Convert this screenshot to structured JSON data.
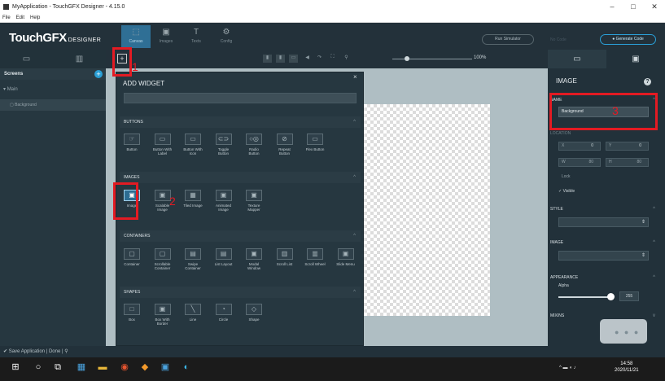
{
  "window": {
    "title": "MyApplication - TouchGFX Designer - 4.15.0",
    "controls": [
      "–",
      "□",
      "✕"
    ]
  },
  "menu": [
    "File",
    "Edit",
    "Help"
  ],
  "logo": {
    "main": "TouchGFX",
    "sub": "DESIGNER"
  },
  "top_tabs": [
    {
      "label": "Canvas",
      "icon": "⬚",
      "active": true
    },
    {
      "label": "Images",
      "icon": "▣",
      "active": false
    },
    {
      "label": "Texts",
      "icon": "T",
      "active": false
    },
    {
      "label": "Config",
      "icon": "⚙",
      "active": false
    }
  ],
  "toolbar": {
    "run_simulator": "Run Simulator",
    "no_code": "No Code",
    "generate_code": "● Generate Code"
  },
  "left_panel": {
    "section": "Screens",
    "tree_main": "Main",
    "tree_background": "Background"
  },
  "canvas": {
    "zoom": "100%",
    "add_widget_icon": "+"
  },
  "add_widget": {
    "title": "ADD WIDGET",
    "close": "×",
    "sections": [
      {
        "name": "BUTTONS",
        "items": [
          {
            "label": "Button",
            "icon": "☞"
          },
          {
            "label": "Button With Label",
            "icon": "▭"
          },
          {
            "label": "Button With Icon",
            "icon": "▭"
          },
          {
            "label": "Toggle Button",
            "icon": "⊂⊃"
          },
          {
            "label": "Radio Button",
            "icon": "○◎"
          },
          {
            "label": "Repeat Button",
            "icon": "⊘"
          },
          {
            "label": "Flex Button",
            "icon": "▭"
          }
        ]
      },
      {
        "name": "IMAGES",
        "items": [
          {
            "label": "Image",
            "icon": "▣",
            "selected": true
          },
          {
            "label": "Scalable Image",
            "icon": "▣"
          },
          {
            "label": "Tiled Image",
            "icon": "▦"
          },
          {
            "label": "Animated Image",
            "icon": "▣"
          },
          {
            "label": "Texture Mapper",
            "icon": "▣"
          }
        ]
      },
      {
        "name": "CONTAINERS",
        "items": [
          {
            "label": "Container",
            "icon": "▢"
          },
          {
            "label": "Scrollable Container",
            "icon": "▢"
          },
          {
            "label": "Swipe Container",
            "icon": "▤"
          },
          {
            "label": "List Layout",
            "icon": "▤"
          },
          {
            "label": "Modal Window",
            "icon": "▣"
          },
          {
            "label": "Scroll List",
            "icon": "▥"
          },
          {
            "label": "Scroll Wheel",
            "icon": "▥"
          },
          {
            "label": "Slide Menu",
            "icon": "▣"
          }
        ]
      },
      {
        "name": "SHAPES",
        "items": [
          {
            "label": "Box",
            "icon": "□"
          },
          {
            "label": "Box With Border",
            "icon": "▣"
          },
          {
            "label": "Line",
            "icon": "╲"
          },
          {
            "label": "Circle",
            "icon": "◔"
          },
          {
            "label": "Shape",
            "icon": "◇"
          }
        ]
      }
    ]
  },
  "properties": {
    "title": "IMAGE",
    "name_header": "NAME",
    "name_value": "Background",
    "location_header": "LOCATION",
    "x_label": "X",
    "x_value": "0",
    "y_label": "Y",
    "y_value": "0",
    "w_label": "W",
    "w_value": "80",
    "h_label": "H",
    "h_value": "80",
    "lock": "Lock",
    "visible": "✓ Visible",
    "style_header": "STYLE",
    "image_header": "IMAGE",
    "appearance_header": "APPEARANCE",
    "alpha_label": "Alpha",
    "alpha_value": "255",
    "mixins_header": "MIXINS"
  },
  "status": "Save Application | Done |",
  "taskbar": {
    "time": "14:58",
    "date": "2020/11/21"
  },
  "annotations": [
    "1",
    "2",
    "3"
  ]
}
